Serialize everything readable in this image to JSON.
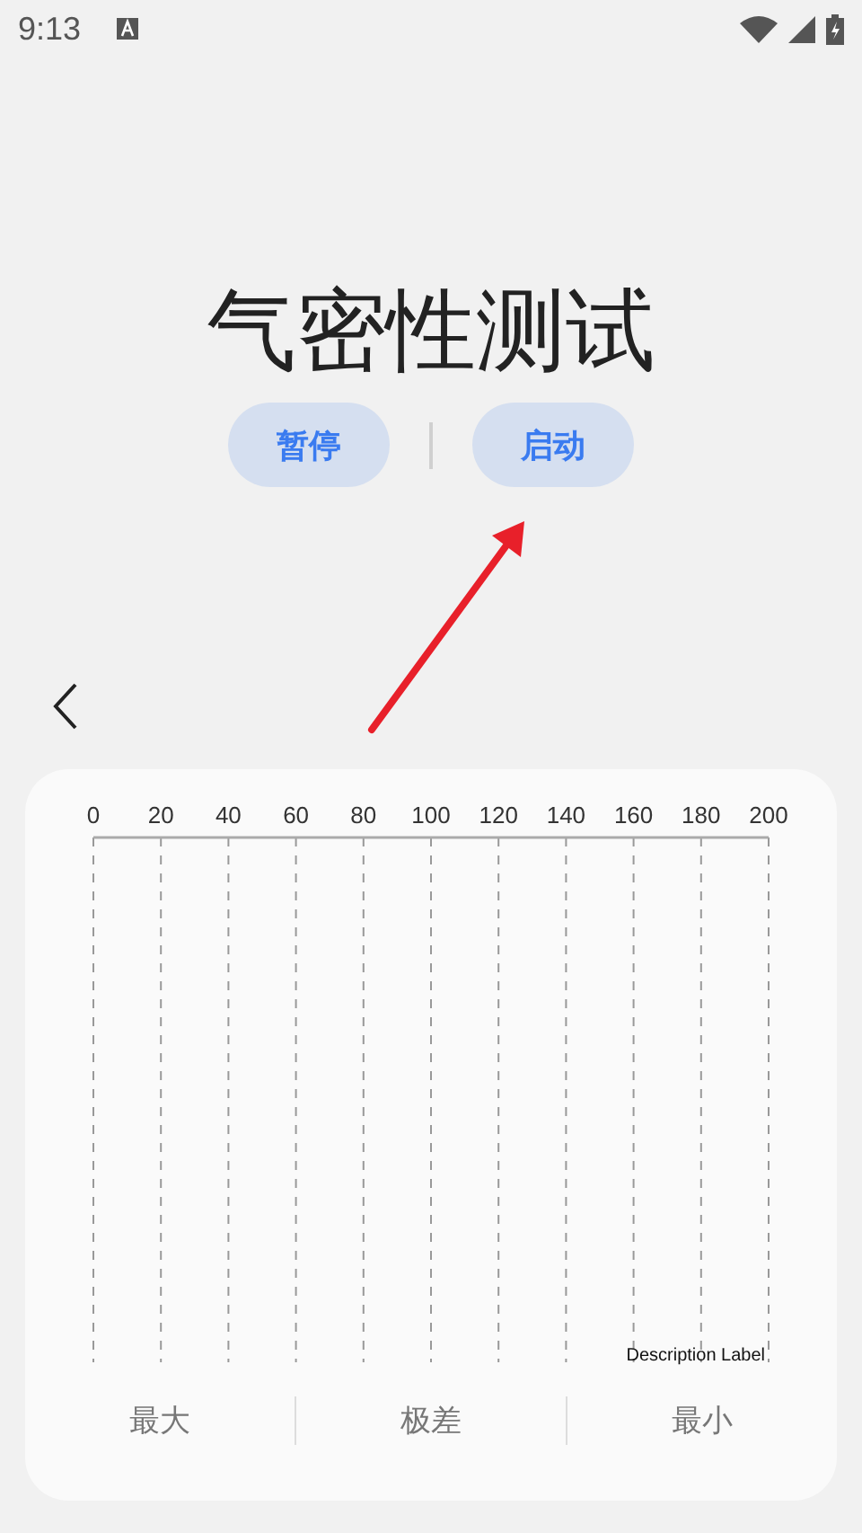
{
  "status_bar": {
    "time": "9:13"
  },
  "title": "气密性测试",
  "buttons": [
    {
      "label": "暂停"
    },
    {
      "label": "启动"
    }
  ],
  "chart": {
    "scale_labels": [
      "0",
      "20",
      "40",
      "60",
      "80",
      "100",
      "120",
      "140",
      "160",
      "180",
      "200"
    ],
    "description_label": "Description Label"
  },
  "stats": [
    {
      "label": "最大"
    },
    {
      "label": "极差"
    },
    {
      "label": "最小"
    }
  ]
}
